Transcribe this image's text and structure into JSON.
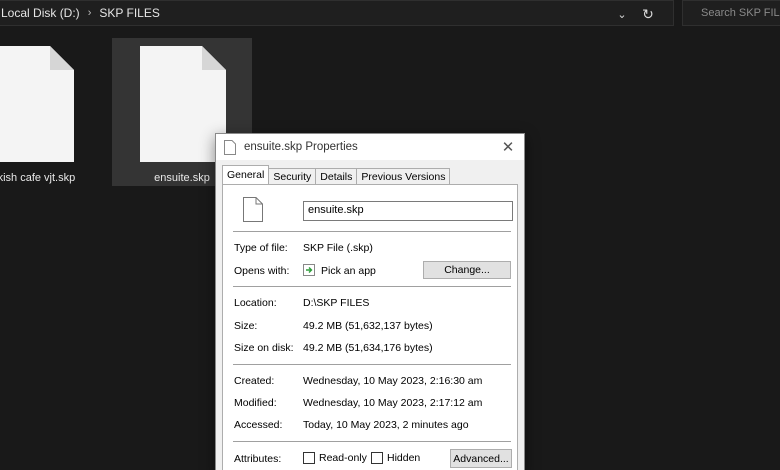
{
  "explorer": {
    "breadcrumb": [
      "Local Disk (D:)",
      "SKP FILES"
    ],
    "search_placeholder": "Search SKP FILES",
    "files": [
      {
        "name": "turkish cafe vjt.skp",
        "selected": false
      },
      {
        "name": "ensuite.skp",
        "selected": true
      }
    ]
  },
  "dialog": {
    "title": "ensuite.skp Properties",
    "close_glyph": "✕",
    "tabs": [
      "General",
      "Security",
      "Details",
      "Previous Versions"
    ],
    "active_tab": "General",
    "file_name": "ensuite.skp",
    "type_label": "Type of file:",
    "type_value": "SKP File (.skp)",
    "opens_label": "Opens with:",
    "opens_value": "Pick an app",
    "change_button": "Change...",
    "location_label": "Location:",
    "location_value": "D:\\SKP FILES",
    "size_label": "Size:",
    "size_value": "49.2 MB (51,632,137 bytes)",
    "size_disk_label": "Size on disk:",
    "size_disk_value": "49.2 MB (51,634,176 bytes)",
    "created_label": "Created:",
    "created_value": "Wednesday, 10 May 2023, 2:16:30 am",
    "modified_label": "Modified:",
    "modified_value": "Wednesday, 10 May 2023, 2:17:12 am",
    "accessed_label": "Accessed:",
    "accessed_value": "Today, 10 May 2023, 2 minutes ago",
    "attributes_label": "Attributes:",
    "readonly_label": "Read-only",
    "hidden_label": "Hidden",
    "advanced_button": "Advanced..."
  },
  "colors": {
    "explorer_bg": "#191919",
    "selected_tile": "#343434",
    "dialog_bg": "#f0f0f0"
  }
}
